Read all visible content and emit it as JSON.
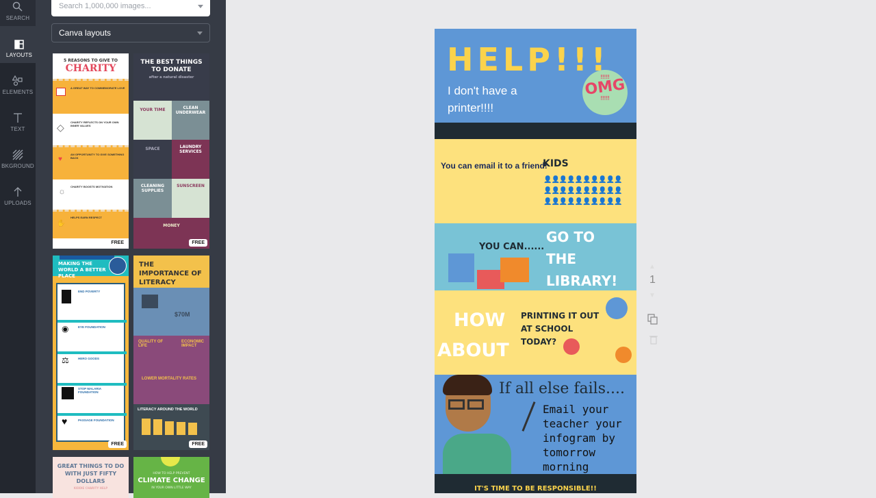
{
  "rail": {
    "items": [
      {
        "label": "SEARCH",
        "icon": "search-icon"
      },
      {
        "label": "LAYOUTS",
        "icon": "layouts-icon",
        "active": true
      },
      {
        "label": "ELEMENTS",
        "icon": "elements-icon"
      },
      {
        "label": "TEXT",
        "icon": "text-icon"
      },
      {
        "label": "BKGROUND",
        "icon": "background-icon"
      },
      {
        "label": "UPLOADS",
        "icon": "upload-icon"
      }
    ]
  },
  "panel": {
    "search_placeholder": "Search 1,000,000 images...",
    "layouts_select": "Canva layouts",
    "free_badge": "FREE",
    "templates": [
      {
        "title_top": "5 REASONS TO GIVE TO",
        "title_main": "CHARITY",
        "rows": [
          "A GREAT WAY TO COMMEMORATE LOVE",
          "CHARITY REFLECTS ON YOUR OWN INNER VALUES",
          "AN OPPORTUNITY TO GIVE SOMETHING BACK",
          "CHARITY BOOSTS MOTIVATION",
          "HELPS EARN RESPECT"
        ]
      },
      {
        "title": "THE BEST THINGS TO DONATE",
        "subtitle": "after a natural disaster",
        "cells": [
          "YOUR TIME",
          "CLEAN UNDERWEAR",
          "SPACE",
          "LAUNDRY SERVICES",
          "CLEANING SUPPLIES",
          "SUNSCREEN",
          "MONEY"
        ]
      },
      {
        "title": "MAKING THE WORLD A BETTER PLACE",
        "items": [
          "END POVERTY",
          "EYE FOUNDATION",
          "HERO GOODS",
          "STOP MALARIA FOUNDATION",
          "PASSAGE FOUNDATION"
        ]
      },
      {
        "title": "THE IMPORTANCE OF LITERACY",
        "stat": "$70M",
        "labels": [
          "QUALITY OF LIFE",
          "ECONOMIC IMPACT",
          "LOWER MORTALITY RATES",
          "LITERACY AROUND THE WORLD"
        ]
      },
      {
        "title": "GREAT THINGS TO DO WITH JUST FIFTY DOLLARS",
        "subtitle": "KIDDIE CHARITY HELP"
      },
      {
        "pre": "HOW TO HELP PREVENT",
        "title": "CLIMATE CHANGE",
        "post": "IN YOUR OWN LITTLE WAY"
      }
    ]
  },
  "design": {
    "help": "HELP!!!",
    "no_printer": "I don't have a printer!!!!",
    "omg_top": "!!!!!",
    "omg": "OMG",
    "omg_bottom": "!!!!!",
    "email_friend": "You can email it  to a friend!",
    "kids": "KIDS",
    "you_can": "YOU CAN......",
    "go_to": "GO TO",
    "the": "THE",
    "library": "LIBRARY!",
    "how": "HOW",
    "about": "ABOUT",
    "printing": "PRINTING IT OUT",
    "at_school": "AT SCHOOL",
    "today": "TODAY?",
    "if_all_else": "If all else fails....",
    "email_teacher": [
      "Email your",
      "teacher your",
      "infogram by",
      "tomorrow",
      "morning"
    ],
    "responsible": "IT'S TIME TO BE RESPONSIBLE!!"
  },
  "page_controls": {
    "page_number": "1"
  },
  "colors": {
    "blue": "#5e97d6",
    "yellow": "#fde17d",
    "teal": "#79c3d6",
    "dark": "#1f2b33",
    "title_yellow": "#fbd34c",
    "omg_red": "#e64667",
    "omg_green": "#a9deb2"
  }
}
